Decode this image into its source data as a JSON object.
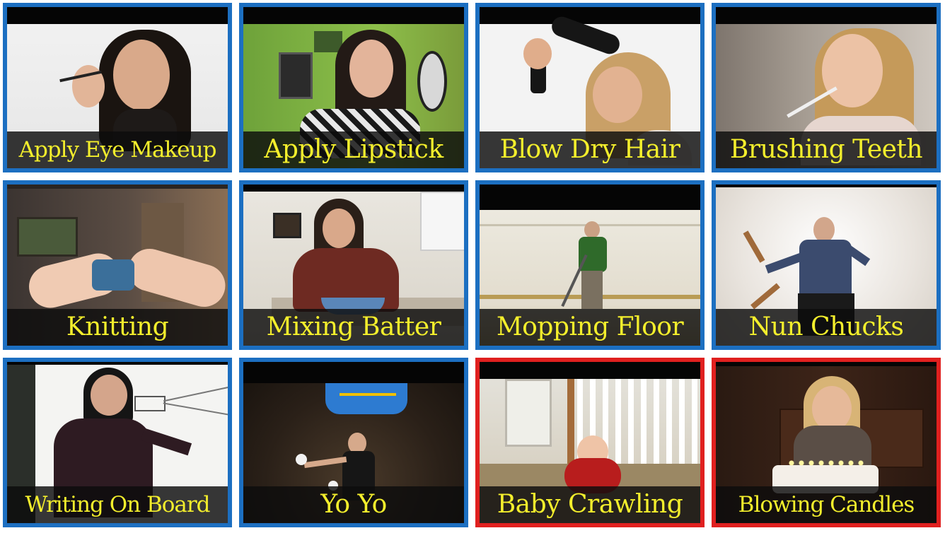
{
  "tiles": [
    {
      "label": "Apply Eye Makeup",
      "highlight": "blue",
      "icon": "eye-makeup-thumbnail"
    },
    {
      "label": "Apply Lipstick",
      "highlight": "blue",
      "icon": "lipstick-thumbnail"
    },
    {
      "label": "Blow Dry Hair",
      "highlight": "blue",
      "icon": "hair-dryer-thumbnail"
    },
    {
      "label": "Brushing Teeth",
      "highlight": "blue",
      "icon": "toothbrush-thumbnail"
    },
    {
      "label": "Knitting",
      "highlight": "blue",
      "icon": "knitting-thumbnail"
    },
    {
      "label": "Mixing Batter",
      "highlight": "blue",
      "icon": "mixing-bowl-thumbnail"
    },
    {
      "label": "Mopping Floor",
      "highlight": "blue",
      "icon": "mop-thumbnail"
    },
    {
      "label": "Nun Chucks",
      "highlight": "blue",
      "icon": "nunchucks-thumbnail"
    },
    {
      "label": "Writing On Board",
      "highlight": "blue",
      "icon": "whiteboard-thumbnail"
    },
    {
      "label": "Yo Yo",
      "highlight": "blue",
      "icon": "yoyo-thumbnail"
    },
    {
      "label": "Baby Crawling",
      "highlight": "red",
      "icon": "baby-crawling-thumbnail"
    },
    {
      "label": "Blowing Candles",
      "highlight": "red",
      "icon": "candles-thumbnail"
    }
  ],
  "colors": {
    "blue_border": "#1c6fc1",
    "red_border": "#e0201f",
    "caption_text": "#f3ee2c"
  }
}
